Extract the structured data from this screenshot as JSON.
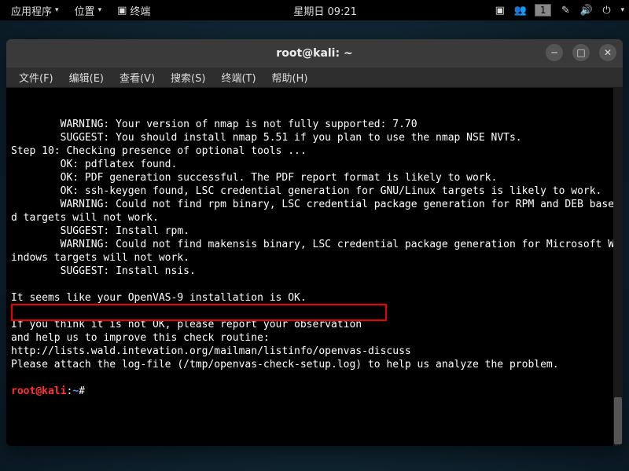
{
  "topbar": {
    "apps": "应用程序",
    "places": "位置",
    "terminal_launcher": "终端",
    "clock": "星期日 09:21",
    "workspace": "1"
  },
  "window": {
    "title": "root@kali: ~"
  },
  "menubar": {
    "file": "文件(F)",
    "edit": "编辑(E)",
    "view": "查看(V)",
    "search": "搜索(S)",
    "terminal": "终端(T)",
    "help": "帮助(H)"
  },
  "terminal": {
    "lines": [
      "        WARNING: Your version of nmap is not fully supported: 7.70",
      "        SUGGEST: You should install nmap 5.51 if you plan to use the nmap NSE NVTs.",
      "Step 10: Checking presence of optional tools ...",
      "        OK: pdflatex found.",
      "        OK: PDF generation successful. The PDF report format is likely to work.",
      "        OK: ssh-keygen found, LSC credential generation for GNU/Linux targets is likely to work.",
      "        WARNING: Could not find rpm binary, LSC credential package generation for RPM and DEB based targets will not work.",
      "        SUGGEST: Install rpm.",
      "        WARNING: Could not find makensis binary, LSC credential package generation for Microsoft Windows targets will not work.",
      "        SUGGEST: Install nsis.",
      "",
      "It seems like your OpenVAS-9 installation is OK.",
      "",
      "If you think it is not OK, please report your observation",
      "and help us to improve this check routine:",
      "http://lists.wald.intevation.org/mailman/listinfo/openvas-discuss",
      "Please attach the log-file (/tmp/openvas-check-setup.log) to help us analyze the problem.",
      ""
    ],
    "prompt": {
      "user": "root",
      "at": "@",
      "host": "kali",
      "colon": ":",
      "path": "~",
      "symbol": "#"
    }
  }
}
